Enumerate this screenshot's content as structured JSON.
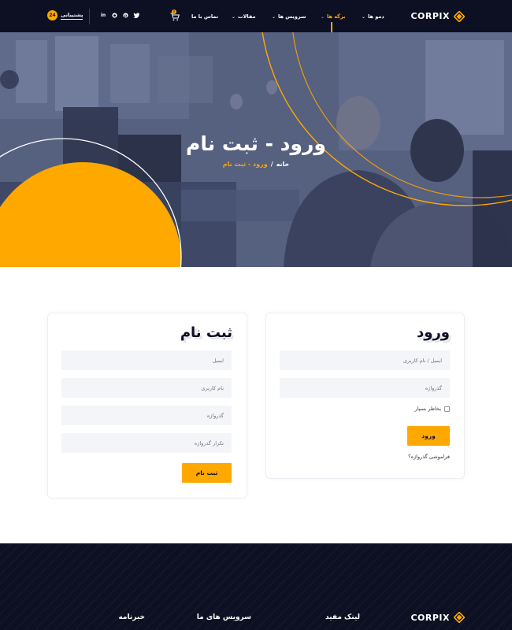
{
  "header": {
    "logo_text": "CORPIX",
    "nav": [
      {
        "label": "دمو ها",
        "id": "demos"
      },
      {
        "label": "برگه ها",
        "id": "pages",
        "active": true
      },
      {
        "label": "سرویس ها",
        "id": "services"
      },
      {
        "label": "مقالات",
        "id": "articles"
      },
      {
        "label": "تماس با ما",
        "id": "contact"
      }
    ],
    "cart_count": "0",
    "socials": [
      "twitter-icon",
      "github-icon",
      "pinterest-icon",
      "linkedin-icon"
    ],
    "support_label": "پشتیبانی",
    "support_icon_text": "24"
  },
  "hero": {
    "title": "ورود - ثبت نام",
    "breadcrumb_home": "خانه",
    "breadcrumb_separator": "/",
    "breadcrumb_current": "ورود - ثبت نام"
  },
  "login": {
    "title": "ورود",
    "username_placeholder": "ایمیل / نام کاربری",
    "password_placeholder": "گذرواژه",
    "remember_label": "بخاطر بسپار",
    "submit_label": "ورود",
    "forgot_label": "فراموشی گذرواژه؟"
  },
  "register": {
    "title": "ثبت نام",
    "email_placeholder": "ایمیل",
    "username_placeholder": "نام کاربری",
    "password_placeholder": "گذرواژه",
    "confirm_placeholder": "تکرار گذرواژه",
    "submit_label": "ثبت نام"
  },
  "footer": {
    "logo_text": "CORPIX",
    "headings": [
      "لینک مفید",
      "سرویس های ما",
      "خبرنامه"
    ]
  },
  "colors": {
    "accent": "#ffa800",
    "dark": "#0d1022",
    "hero_overlay": "#4b5577"
  }
}
